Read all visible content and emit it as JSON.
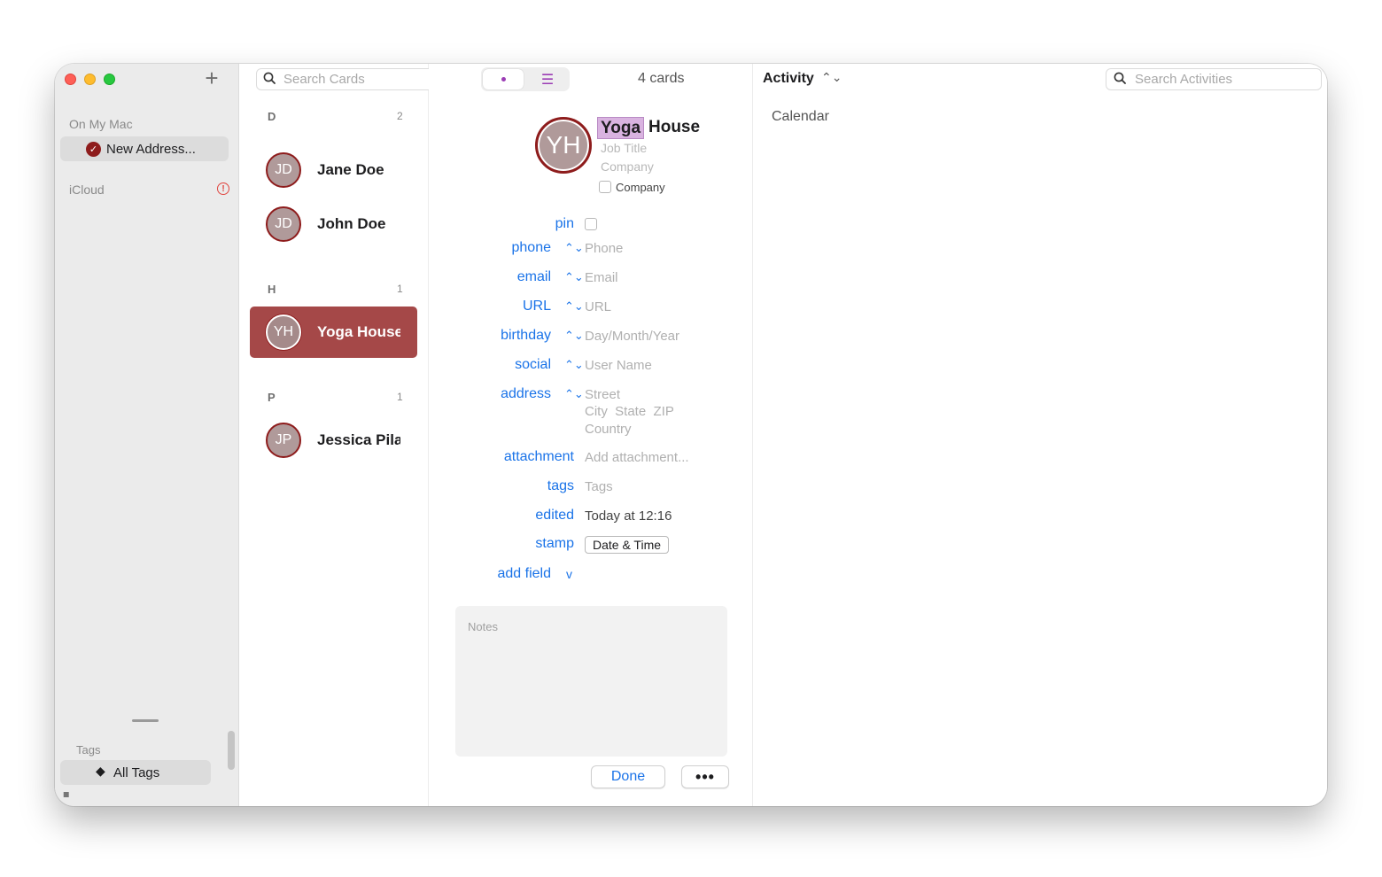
{
  "sidebar": {
    "add_label": "+",
    "on_my_mac": "On My Mac",
    "address_book": "New Address...",
    "icloud": "iCloud",
    "tags_label": "Tags",
    "all_tags": "All Tags"
  },
  "cardlist": {
    "search_placeholder": "Search Cards",
    "groups": [
      {
        "letter": "D",
        "count": "2"
      },
      {
        "letter": "H",
        "count": "1"
      },
      {
        "letter": "P",
        "count": "1"
      }
    ],
    "contacts": [
      {
        "initials": "JD",
        "name": "Jane Doe"
      },
      {
        "initials": "JD",
        "name": "John Doe"
      },
      {
        "initials": "YH",
        "name": "Yoga House"
      },
      {
        "initials": "JP",
        "name": "Jessica Pila"
      }
    ]
  },
  "detail": {
    "card_count": "4 cards",
    "initials": "YH",
    "first_name": "Yoga",
    "last_name": "House",
    "job_title_placeholder": "Job Title",
    "company_placeholder": "Company",
    "company_checkbox_label": "Company",
    "fields": {
      "pin": "pin",
      "phone": "phone",
      "phone_ph": "Phone",
      "email": "email",
      "email_ph": "Email",
      "url": "URL",
      "url_ph": "URL",
      "birthday": "birthday",
      "birthday_ph": "Day/Month/Year",
      "social": "social",
      "social_ph": "User Name",
      "address": "address",
      "street_ph": "Street",
      "city_ph": "City  State  ZIP",
      "country_ph": "Country",
      "attachment": "attachment",
      "attachment_ph": "Add attachment...",
      "tags": "tags",
      "tags_ph": "Tags",
      "edited": "edited",
      "edited_value": "Today at 12:16",
      "stamp": "stamp",
      "stamp_button": "Date & Time",
      "add_field": "add field",
      "add_field_chevron": "v"
    },
    "notes_placeholder": "Notes",
    "done_label": "Done",
    "more_label": "•••"
  },
  "activity": {
    "title": "Activity",
    "search_placeholder": "Search Activities",
    "calendar_label": "Calendar"
  },
  "colors": {
    "accent_blue": "#1a73e8",
    "selection_red": "#a54848",
    "avatar_border": "#8e1c1c",
    "segment_purple": "#9b3db5"
  }
}
